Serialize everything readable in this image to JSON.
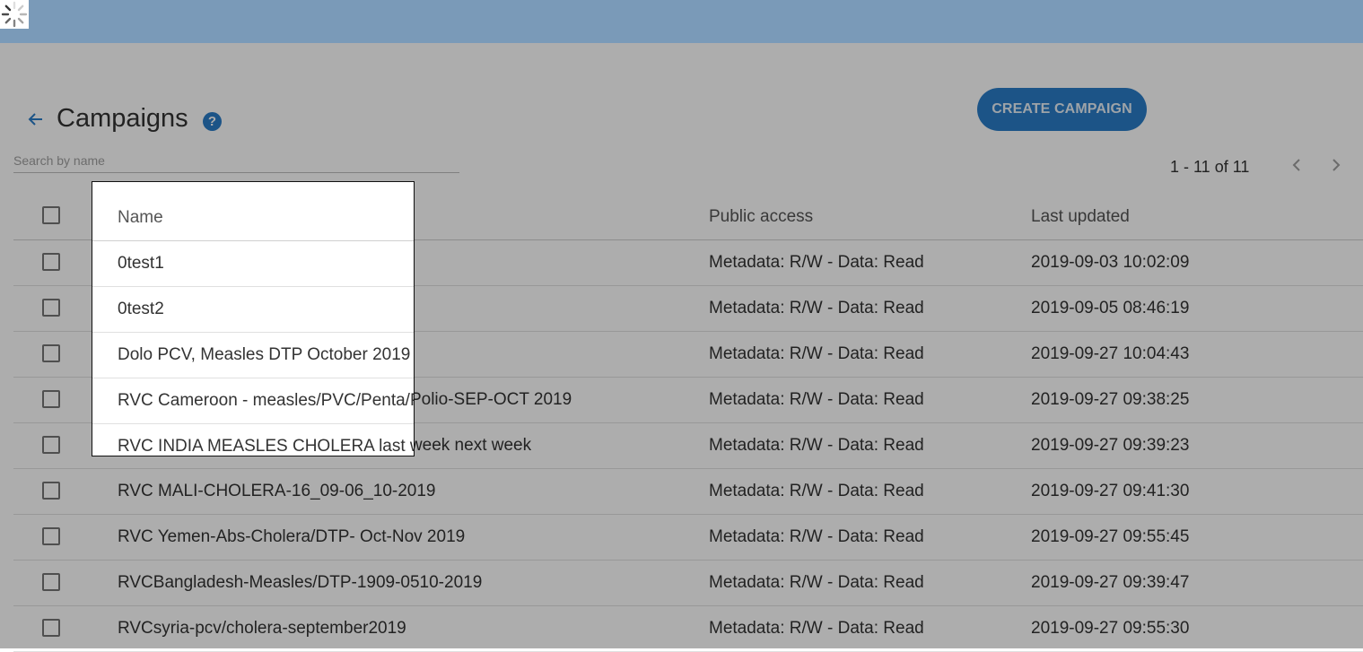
{
  "page": {
    "title": "Campaigns",
    "back_icon": "arrow-left-icon",
    "help_icon": "help-circle-icon",
    "help_glyph": "?"
  },
  "toolbar": {
    "create_label": "CREATE CAMPAIGN",
    "search_placeholder": "Search by name"
  },
  "pagination": {
    "range": "1 - 11 of 11",
    "prev_icon": "chevron-left-icon",
    "next_icon": "chevron-right-icon"
  },
  "table": {
    "columns": [
      "Name",
      "Public access",
      "Last updated"
    ],
    "rows": [
      {
        "name": "0test1",
        "public": "Metadata: R/W - Data: Read",
        "updated": "2019-09-03 10:02:09"
      },
      {
        "name": "0test2",
        "public": "Metadata: R/W - Data: Read",
        "updated": "2019-09-05 08:46:19"
      },
      {
        "name": "Dolo PCV, Measles DTP October 2019",
        "public": "Metadata: R/W - Data: Read",
        "updated": "2019-09-27 10:04:43"
      },
      {
        "name": "RVC Cameroon - measles/PVC/Penta/Polio-SEP-OCT 2019",
        "public": "Metadata: R/W - Data: Read",
        "updated": "2019-09-27 09:38:25"
      },
      {
        "name": "RVC INDIA MEASLES CHOLERA last week next week",
        "public": "Metadata: R/W - Data: Read",
        "updated": "2019-09-27 09:39:23"
      },
      {
        "name": "RVC MALI-CHOLERA-16_09-06_10-2019",
        "public": "Metadata: R/W - Data: Read",
        "updated": "2019-09-27 09:41:30"
      },
      {
        "name": "RVC Yemen-Abs-Cholera/DTP- Oct-Nov 2019",
        "public": "Metadata: R/W - Data: Read",
        "updated": "2019-09-27 09:55:45"
      },
      {
        "name": "RVCBangladesh-Measles/DTP-1909-0510-2019",
        "public": "Metadata: R/W - Data: Read",
        "updated": "2019-09-27 09:39:47"
      },
      {
        "name": "RVCsyria-pcv/cholera-september2019",
        "public": "Metadata: R/W - Data: Read",
        "updated": "2019-09-27 09:55:30"
      }
    ]
  },
  "colors": {
    "topbar": "#7a9ab8",
    "accent": "#2a7cc7",
    "overlay": "rgba(0,0,0,0.32)"
  }
}
